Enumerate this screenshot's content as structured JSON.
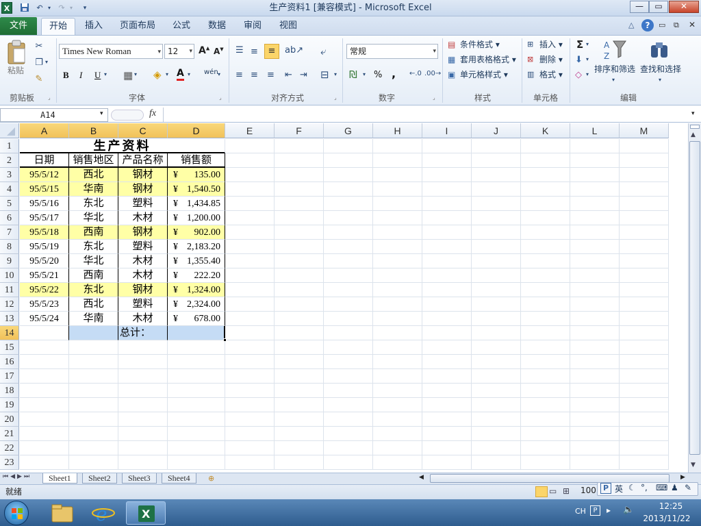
{
  "titlebar": {
    "title": "生产资料1  [兼容模式]  -  Microsoft Excel",
    "logo": "X",
    "minimize": "—",
    "restore": "▭",
    "close": "✕"
  },
  "qat": {
    "save_icon": "save-icon",
    "undo_icon": "undo-icon",
    "redo_icon": "redo-icon"
  },
  "tabs": {
    "file": "文件",
    "home": "开始",
    "insert": "插入",
    "pagelayout": "页面布局",
    "formulas": "公式",
    "data": "数据",
    "review": "审阅",
    "view": "视图"
  },
  "ribbon": {
    "clipboard": {
      "label": "剪贴板",
      "paste": "粘贴"
    },
    "font": {
      "label": "字体",
      "family": "Times New Roman",
      "size": "12",
      "bold": "B",
      "italic": "I",
      "underline": "U",
      "grow": "A",
      "shrink": "A",
      "fontcolor": "A",
      "wen": "wén"
    },
    "alignment": {
      "label": "对齐方式"
    },
    "number": {
      "label": "数字",
      "format": "常规",
      "percent": "%",
      "comma": ","
    },
    "styles": {
      "label": "样式",
      "conditional": "条件格式",
      "table": "套用表格格式",
      "cell": "单元格样式"
    },
    "cells": {
      "label": "单元格",
      "insert": "插入",
      "delete": "删除",
      "format": "格式"
    },
    "editing": {
      "label": "编辑",
      "sigma": "Σ",
      "sort": "排序和筛选",
      "find": "查找和选择"
    }
  },
  "formula_bar": {
    "name_box": "A14",
    "fx": "fx",
    "value": ""
  },
  "columns": [
    "A",
    "B",
    "C",
    "D",
    "E",
    "F",
    "G",
    "H",
    "I",
    "J",
    "K",
    "L",
    "M"
  ],
  "rows": [
    "1",
    "2",
    "3",
    "4",
    "5",
    "6",
    "7",
    "8",
    "9",
    "10",
    "11",
    "12",
    "13",
    "14",
    "15",
    "16",
    "17",
    "18",
    "19",
    "20",
    "21",
    "22",
    "23"
  ],
  "sheet": {
    "title": "生产资料",
    "headers": [
      "日期",
      "销售地区",
      "产品名称",
      "销售额"
    ],
    "records": [
      {
        "date": "95/5/12",
        "region": "西北",
        "product": "钢材",
        "currency": "¥",
        "amount": "135.00",
        "highlight": true
      },
      {
        "date": "95/5/15",
        "region": "华南",
        "product": "钢材",
        "currency": "¥",
        "amount": "1,540.50",
        "highlight": true
      },
      {
        "date": "95/5/16",
        "region": "东北",
        "product": "塑料",
        "currency": "¥",
        "amount": "1,434.85",
        "highlight": false
      },
      {
        "date": "95/5/17",
        "region": "华北",
        "product": "木材",
        "currency": "¥",
        "amount": "1,200.00",
        "highlight": false
      },
      {
        "date": "95/5/18",
        "region": "西南",
        "product": "钢材",
        "currency": "¥",
        "amount": "902.00",
        "highlight": true
      },
      {
        "date": "95/5/19",
        "region": "东北",
        "product": "塑料",
        "currency": "¥",
        "amount": "2,183.20",
        "highlight": false
      },
      {
        "date": "95/5/20",
        "region": "华北",
        "product": "木材",
        "currency": "¥",
        "amount": "1,355.40",
        "highlight": false
      },
      {
        "date": "95/5/21",
        "region": "西南",
        "product": "木材",
        "currency": "¥",
        "amount": "222.20",
        "highlight": false
      },
      {
        "date": "95/5/22",
        "region": "东北",
        "product": "钢材",
        "currency": "¥",
        "amount": "1,324.00",
        "highlight": true
      },
      {
        "date": "95/5/23",
        "region": "西北",
        "product": "塑料",
        "currency": "¥",
        "amount": "2,324.00",
        "highlight": false
      },
      {
        "date": "95/5/24",
        "region": "华南",
        "product": "木材",
        "currency": "¥",
        "amount": "678.00",
        "highlight": false
      }
    ],
    "total_label": "总计："
  },
  "sheet_tabs": [
    "Sheet1",
    "Sheet2",
    "Sheet3",
    "Sheet4"
  ],
  "status": {
    "ready": "就绪",
    "zoom": "100"
  },
  "ime": {
    "p": "P",
    "lang": "英"
  },
  "tray": {
    "lang": "CH",
    "time": "12:25",
    "date": "2013/11/22"
  },
  "colors": {
    "highlight": "#ffffa6",
    "selected_header": "#f1c15a",
    "total_fill": "#c5dcf5",
    "file_tab": "#1f6d34"
  }
}
